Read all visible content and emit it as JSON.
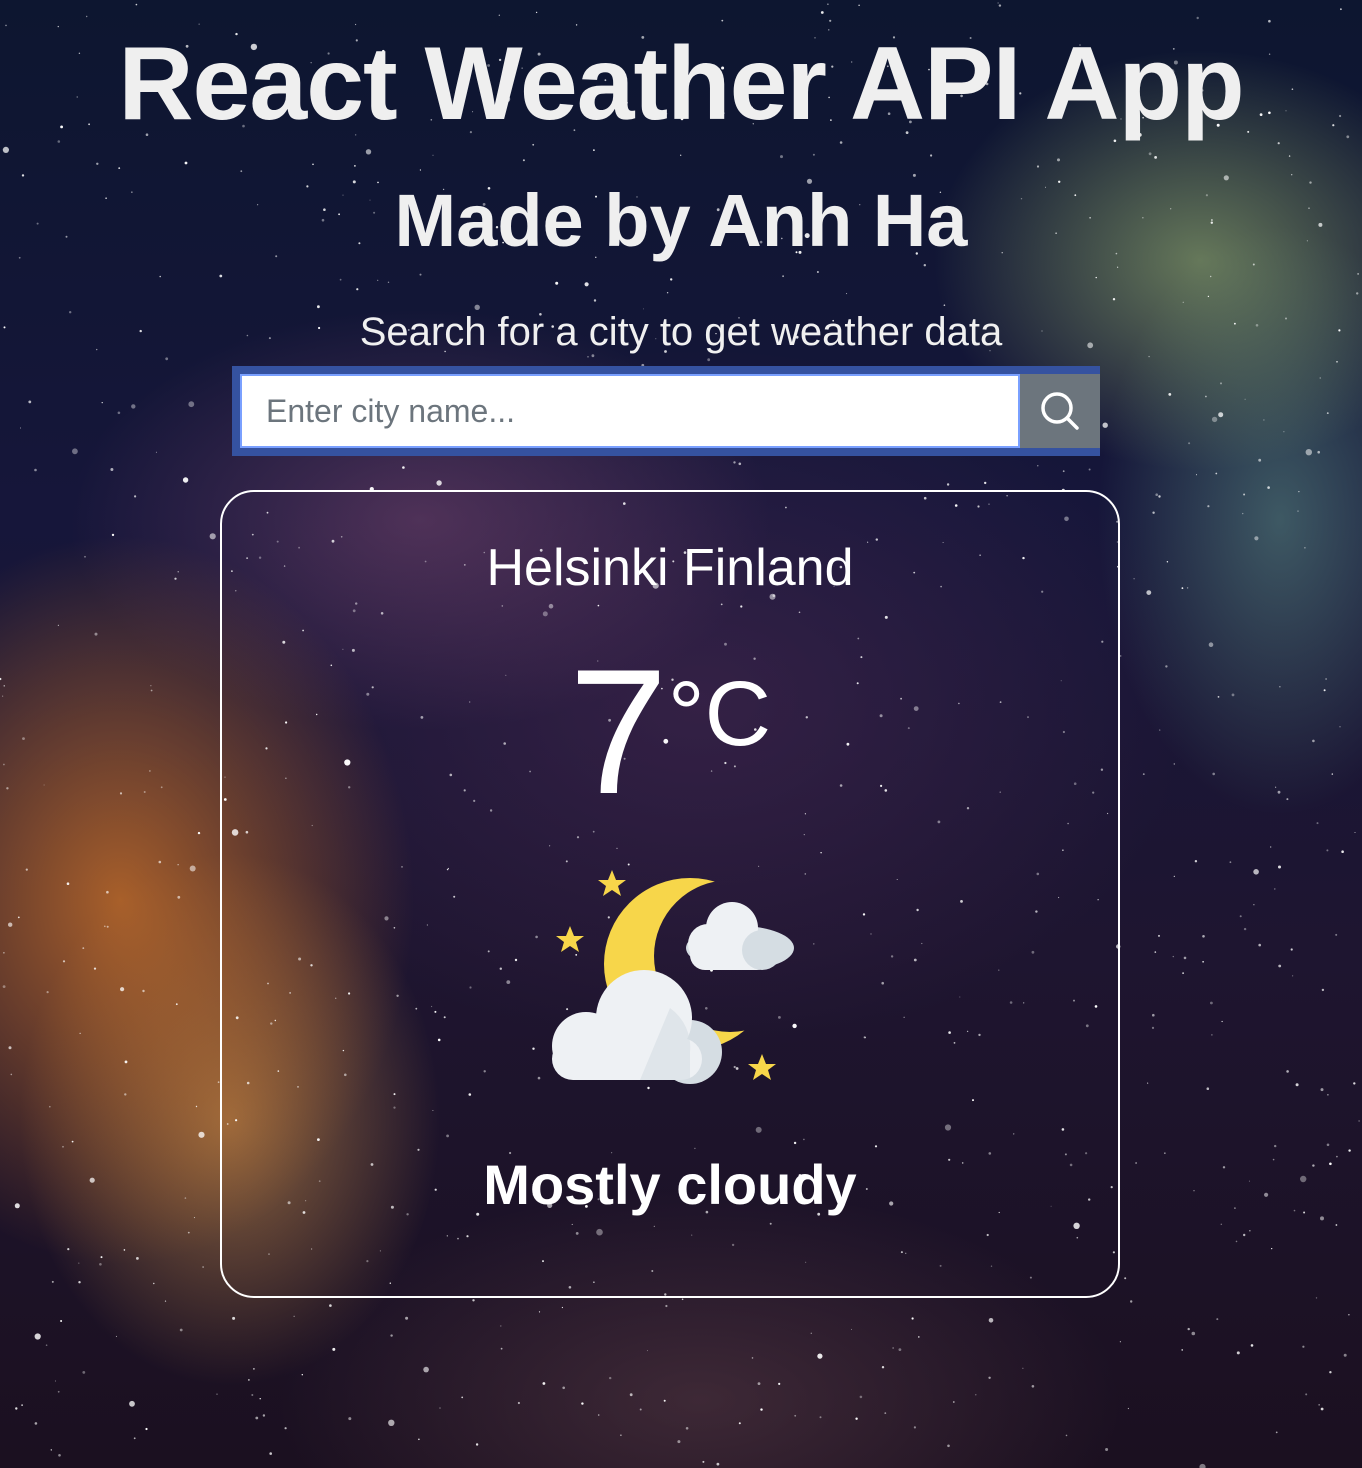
{
  "header": {
    "title": "React Weather API App",
    "subtitle": "Made by Anh Ha",
    "prompt": "Search for a city to get weather data"
  },
  "search": {
    "placeholder": "Enter city name...",
    "value": "",
    "button_icon": "search-icon"
  },
  "weather": {
    "location": "Helsinki Finland",
    "temperature": "7",
    "unit": "°C",
    "icon": "moon-cloud-stars-icon",
    "description": "Mostly cloudy"
  },
  "colors": {
    "accent": "#3552a0",
    "button": "#6c757d",
    "moon": "#f7d64a",
    "cloud": "#eef1f4"
  }
}
